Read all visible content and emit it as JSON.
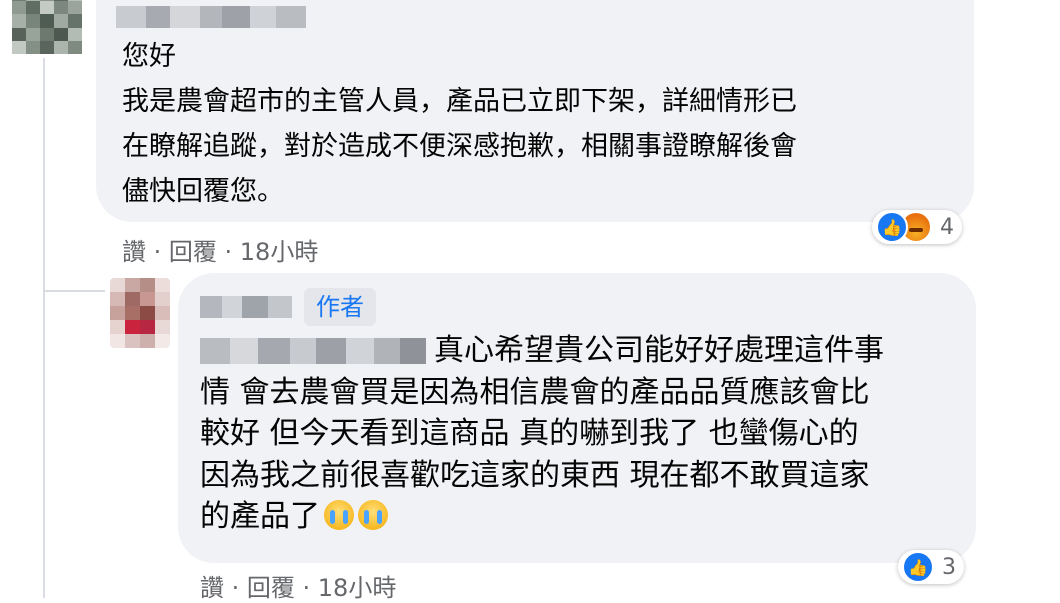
{
  "comments": [
    {
      "text_lines": [
        "您好",
        "我是農會超市的主管人員，產品已立即下架，詳細情形已",
        "在瞭解追蹤，對於造成不便深感抱歉，相關事證瞭解後會",
        "儘快回覆您。"
      ],
      "actions": {
        "like": "讚",
        "reply": "回覆",
        "separator": " · ",
        "time": "18小時"
      },
      "reactions": {
        "icons": [
          "like-icon",
          "angry-icon"
        ],
        "count": "4"
      }
    },
    {
      "author_badge": "作者",
      "text_lines": [
        "真心希望貴公司能好好處理這件事",
        "情 會去農會買是因為相信農會的產品品質應該會比",
        "較好 但今天看到這商品 真的嚇到我了 也蠻傷心的",
        "因為我之前很喜歡吃這家的東西 現在都不敢買這家",
        "的產品了"
      ],
      "emoji": [
        "loudly-crying-face-icon",
        "loudly-crying-face-icon"
      ],
      "actions": {
        "like": "讚",
        "reply": "回覆",
        "separator": " · ",
        "time": "18小時"
      },
      "reactions": {
        "icons": [
          "like-icon"
        ],
        "count": "3"
      }
    }
  ],
  "colors": {
    "bubble": "#f0f2f5",
    "text": "#050505",
    "secondary": "#65676b",
    "accent": "#1877f2"
  }
}
